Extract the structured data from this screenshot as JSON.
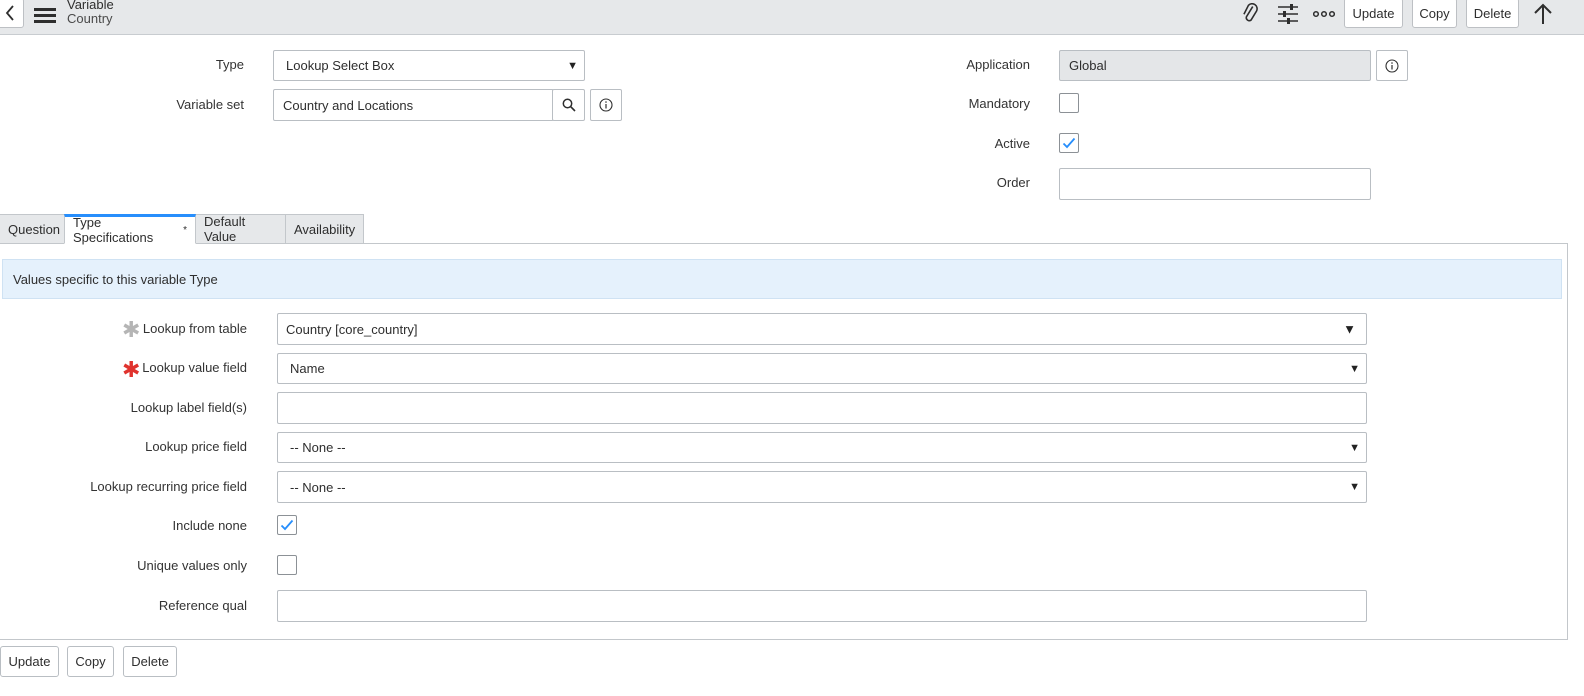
{
  "header": {
    "title": "Variable",
    "subtitle": "Country",
    "buttons": {
      "update": "Update",
      "copy": "Copy",
      "delete": "Delete"
    }
  },
  "form": {
    "type": {
      "label": "Type",
      "value": "Lookup Select Box"
    },
    "variable_set": {
      "label": "Variable set",
      "value": "Country and Locations"
    },
    "application": {
      "label": "Application",
      "value": "Global"
    },
    "mandatory": {
      "label": "Mandatory",
      "checked": false
    },
    "active": {
      "label": "Active",
      "checked": true
    },
    "order": {
      "label": "Order",
      "value": ""
    }
  },
  "tabs": [
    {
      "label": "Question",
      "active": false
    },
    {
      "label": "Type Specifications",
      "active": true,
      "marker": "*"
    },
    {
      "label": "Default Value",
      "active": false
    },
    {
      "label": "Availability",
      "active": false
    }
  ],
  "type_specifications": {
    "banner": "Values specific to this variable Type",
    "lookup_from_table": {
      "label": "Lookup from table",
      "value": "Country [core_country]"
    },
    "lookup_value_field": {
      "label": "Lookup value field",
      "value": "Name"
    },
    "lookup_label_fields": {
      "label": "Lookup label field(s)",
      "value": ""
    },
    "lookup_price_field": {
      "label": "Lookup price field",
      "value": "-- None --"
    },
    "lookup_recurring_price_field": {
      "label": "Lookup recurring price field",
      "value": "-- None --"
    },
    "include_none": {
      "label": "Include none",
      "checked": true
    },
    "unique_values_only": {
      "label": "Unique values only",
      "checked": false
    },
    "reference_qual": {
      "label": "Reference qual",
      "value": ""
    }
  },
  "footer": {
    "update": "Update",
    "copy": "Copy",
    "delete": "Delete"
  },
  "colors": {
    "accent": "#278efc",
    "required": "#e0332e",
    "banner": "#e5f1fc",
    "check": "#278efc"
  }
}
